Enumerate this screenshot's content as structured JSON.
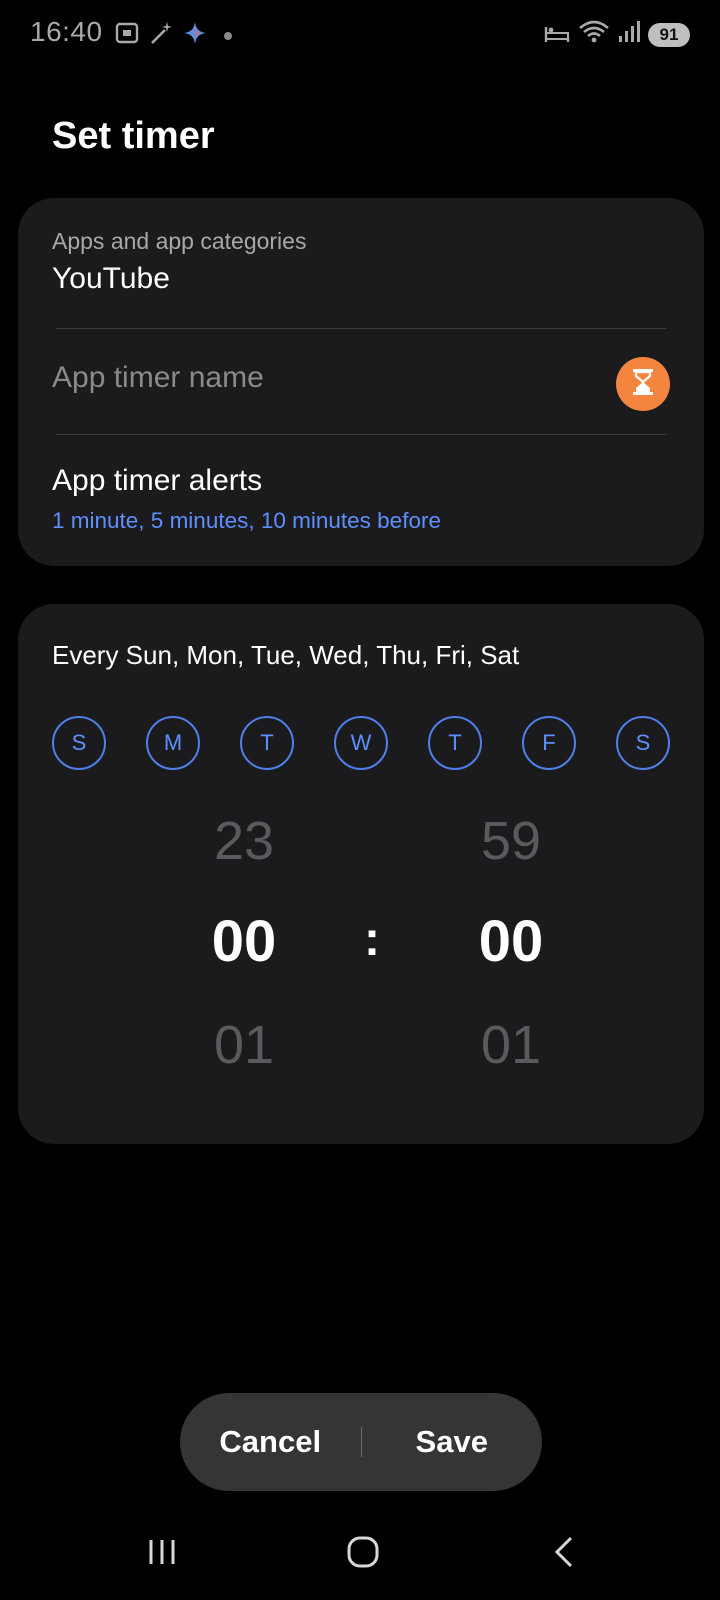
{
  "status_bar": {
    "time": "16:40",
    "battery": "91"
  },
  "title": "Set timer",
  "apps_field": {
    "label": "Apps and app categories",
    "value": "YouTube"
  },
  "timer_name": {
    "placeholder": "App timer name",
    "icon": "hourglass-icon",
    "icon_bg": "#f4853f"
  },
  "alerts": {
    "title": "App timer alerts",
    "subtitle": "1 minute, 5 minutes, 10 minutes before",
    "accent": "#5e8fff"
  },
  "schedule": {
    "repeat_text": "Every Sun, Mon, Tue, Wed, Thu, Fri, Sat",
    "days": [
      "S",
      "M",
      "T",
      "W",
      "T",
      "F",
      "S"
    ]
  },
  "picker": {
    "hours": {
      "prev": "23",
      "current": "00",
      "next": "01"
    },
    "minutes": {
      "prev": "59",
      "current": "00",
      "next": "01"
    },
    "separator": ":"
  },
  "actions": {
    "cancel": "Cancel",
    "save": "Save"
  }
}
